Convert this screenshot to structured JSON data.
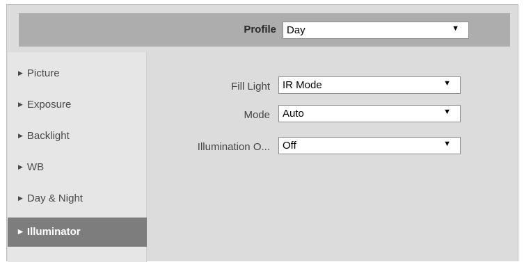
{
  "profile": {
    "label": "Profile",
    "value": "Day"
  },
  "sidebar": {
    "items": [
      {
        "label": "Picture",
        "active": false
      },
      {
        "label": "Exposure",
        "active": false
      },
      {
        "label": "Backlight",
        "active": false
      },
      {
        "label": "WB",
        "active": false
      },
      {
        "label": "Day & Night",
        "active": false
      },
      {
        "label": "Illuminator",
        "active": true
      }
    ]
  },
  "form": {
    "fill_light": {
      "label": "Fill Light",
      "value": "IR Mode"
    },
    "mode": {
      "label": "Mode",
      "value": "Auto"
    },
    "illumination": {
      "label": "Illumination O...",
      "value": "Off"
    }
  },
  "icons": {
    "menu_expand": "triangle-right-icon",
    "dropdown": "triangle-down-icon"
  },
  "colors": {
    "active_item_bg": "#7d7d7d",
    "header_bar": "#adadad",
    "panel_bg": "#dcdcdc"
  }
}
